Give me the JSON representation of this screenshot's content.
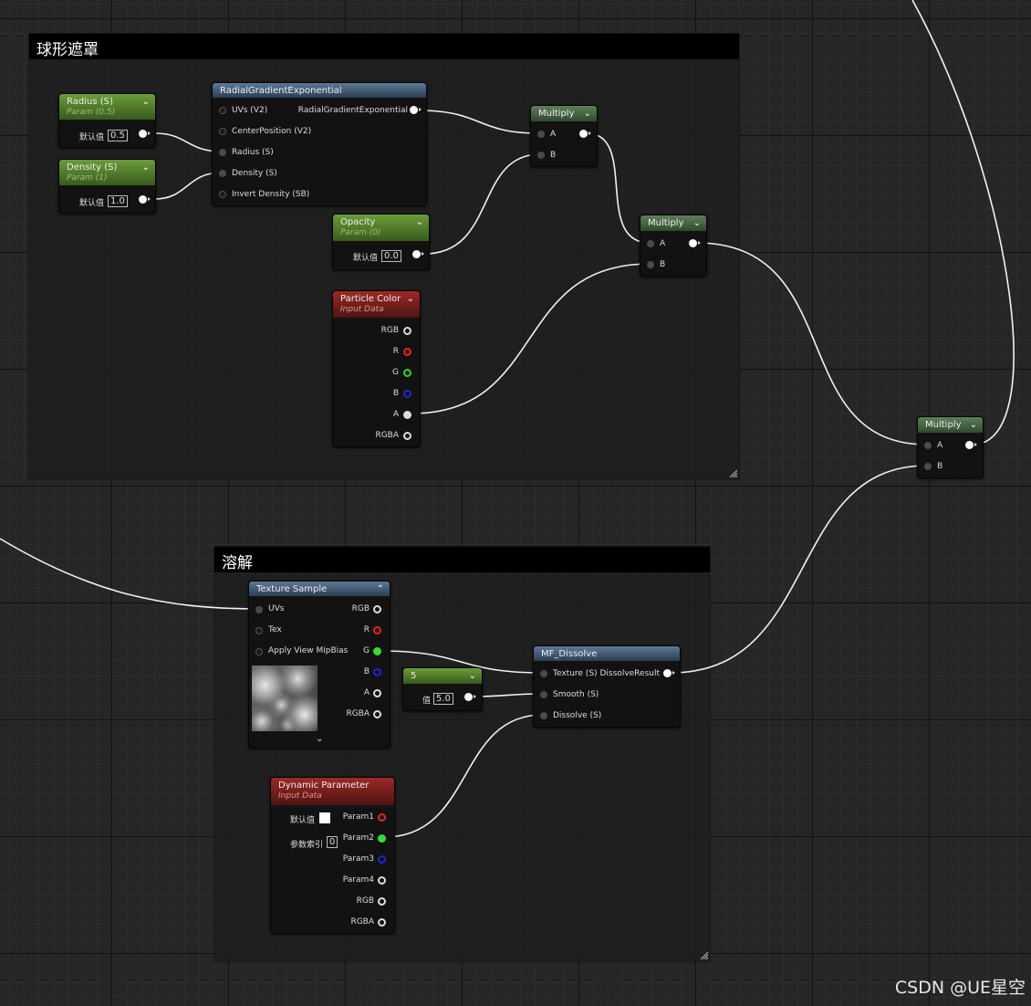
{
  "comments": {
    "sphere_mask": "球形遮罩",
    "dissolve": "溶解"
  },
  "nodes": {
    "radius": {
      "title": "Radius (S)",
      "sub": "Param (0.5)",
      "default_label": "默认值",
      "value": "0.5"
    },
    "density": {
      "title": "Density (S)",
      "sub": "Param (1)",
      "default_label": "默认值",
      "value": "1.0"
    },
    "radial": {
      "title": "RadialGradientExponential",
      "inputs": [
        "UVs (V2)",
        "CenterPosition (V2)",
        "Radius (S)",
        "Density (S)",
        "Invert Density (SB)"
      ],
      "output": "RadialGradientExponential"
    },
    "opacity": {
      "title": "Opacity",
      "sub": "Param (0)",
      "default_label": "默认值",
      "value": "0.0"
    },
    "multiply1": {
      "title": "Multiply",
      "in_a": "A",
      "in_b": "B"
    },
    "multiply2": {
      "title": "Multiply",
      "in_a": "A",
      "in_b": "B"
    },
    "multiply3": {
      "title": "Multiply",
      "in_a": "A",
      "in_b": "B"
    },
    "particle_color": {
      "title": "Particle Color",
      "sub": "Input Data",
      "outputs": [
        "RGB",
        "R",
        "G",
        "B",
        "A",
        "RGBA"
      ]
    },
    "texture_sample": {
      "title": "Texture Sample",
      "inputs": [
        "UVs",
        "Tex",
        "Apply View MipBias"
      ],
      "outputs": [
        "RGB",
        "R",
        "G",
        "B",
        "A",
        "RGBA"
      ]
    },
    "const5": {
      "title": "5",
      "value_label": "值",
      "value": "5.0"
    },
    "mf_dissolve": {
      "title": "MF_Dissolve",
      "inputs": [
        "Texture (S)",
        "Smooth (S)",
        "Dissolve (S)"
      ],
      "output": "DissolveResult"
    },
    "dynamic_param": {
      "title": "Dynamic Parameter",
      "sub": "Input Data",
      "default_label": "默认值",
      "index_label": "参数索引",
      "index_value": "0",
      "outputs": [
        "Param1",
        "Param2",
        "Param3",
        "Param4",
        "RGB",
        "RGBA"
      ]
    }
  },
  "watermark": "CSDN @UE星空",
  "colors": {
    "param_header": "#5a8a30",
    "function_header": "#4a6580",
    "multiply_header": "#4a6a45",
    "input_data_header": "#8a2420",
    "wire": "#ffffff"
  }
}
